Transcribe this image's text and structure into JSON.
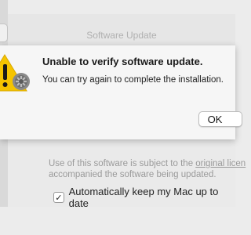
{
  "window": {
    "title": "Software Update"
  },
  "alert": {
    "title": "Unable to verify software update.",
    "message": "You can try again to complete the installation.",
    "ok_label": "OK",
    "icon": "warning-gear-icon"
  },
  "settings": {
    "license_prefix": "Use of this software is subject to the ",
    "license_link": "original licen",
    "license_line2": "accompanied the software being updated.",
    "auto_update_label": "Automatically keep my Mac up to date",
    "auto_update_checked": true
  },
  "colors": {
    "warning_yellow": "#f5c400",
    "sheet_bg": "#f6f6f6",
    "window_bg": "#eaeaea"
  }
}
